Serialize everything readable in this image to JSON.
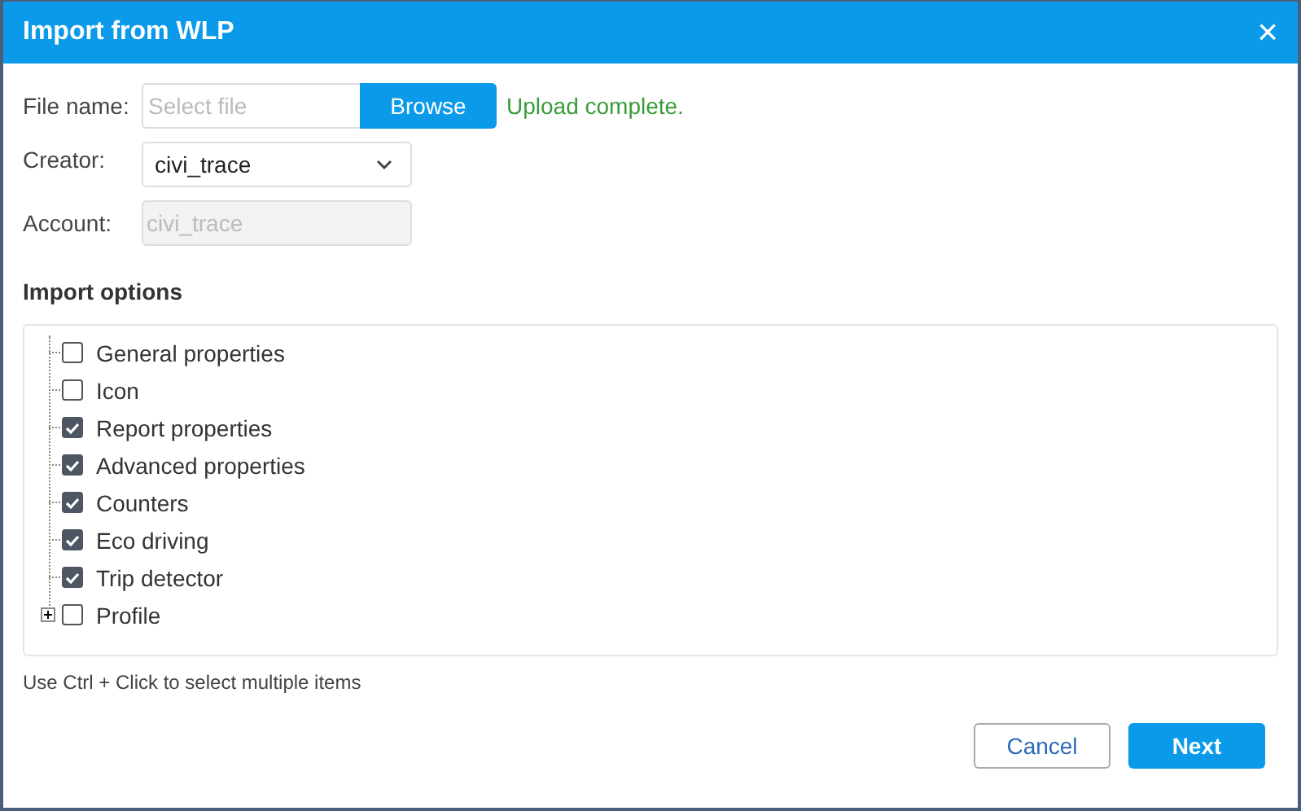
{
  "window": {
    "title": "Import from WLP",
    "close": "×"
  },
  "file_name": {
    "label": "File name:",
    "placeholder": "Select file",
    "button": "Browse",
    "status": "Upload complete."
  },
  "creator": {
    "label": "Creator:",
    "value": "civi_trace"
  },
  "account": {
    "label": "Account:",
    "value": "civi_trace",
    "disabled": true
  },
  "import_options": {
    "title": "Import options",
    "items": [
      {
        "kind": "leaf",
        "label": "General properties",
        "checked": false
      },
      {
        "kind": "leaf",
        "label": "Icon",
        "checked": false
      },
      {
        "kind": "leaf",
        "label": "Report properties",
        "checked": true
      },
      {
        "kind": "leaf",
        "label": "Advanced properties",
        "checked": true
      },
      {
        "kind": "leaf",
        "label": "Counters",
        "checked": true
      },
      {
        "kind": "leaf",
        "label": "Eco driving",
        "checked": true
      },
      {
        "kind": "leaf",
        "label": "Trip detector",
        "checked": true
      },
      {
        "kind": "group",
        "label": "Profile",
        "checked": false,
        "expanded": false
      }
    ],
    "hint": "Use Ctrl + Click to select multiple items"
  },
  "buttons": [
    {
      "kind": "secondary",
      "label": "Cancel"
    },
    {
      "kind": "primary",
      "label": "Next"
    }
  ]
}
